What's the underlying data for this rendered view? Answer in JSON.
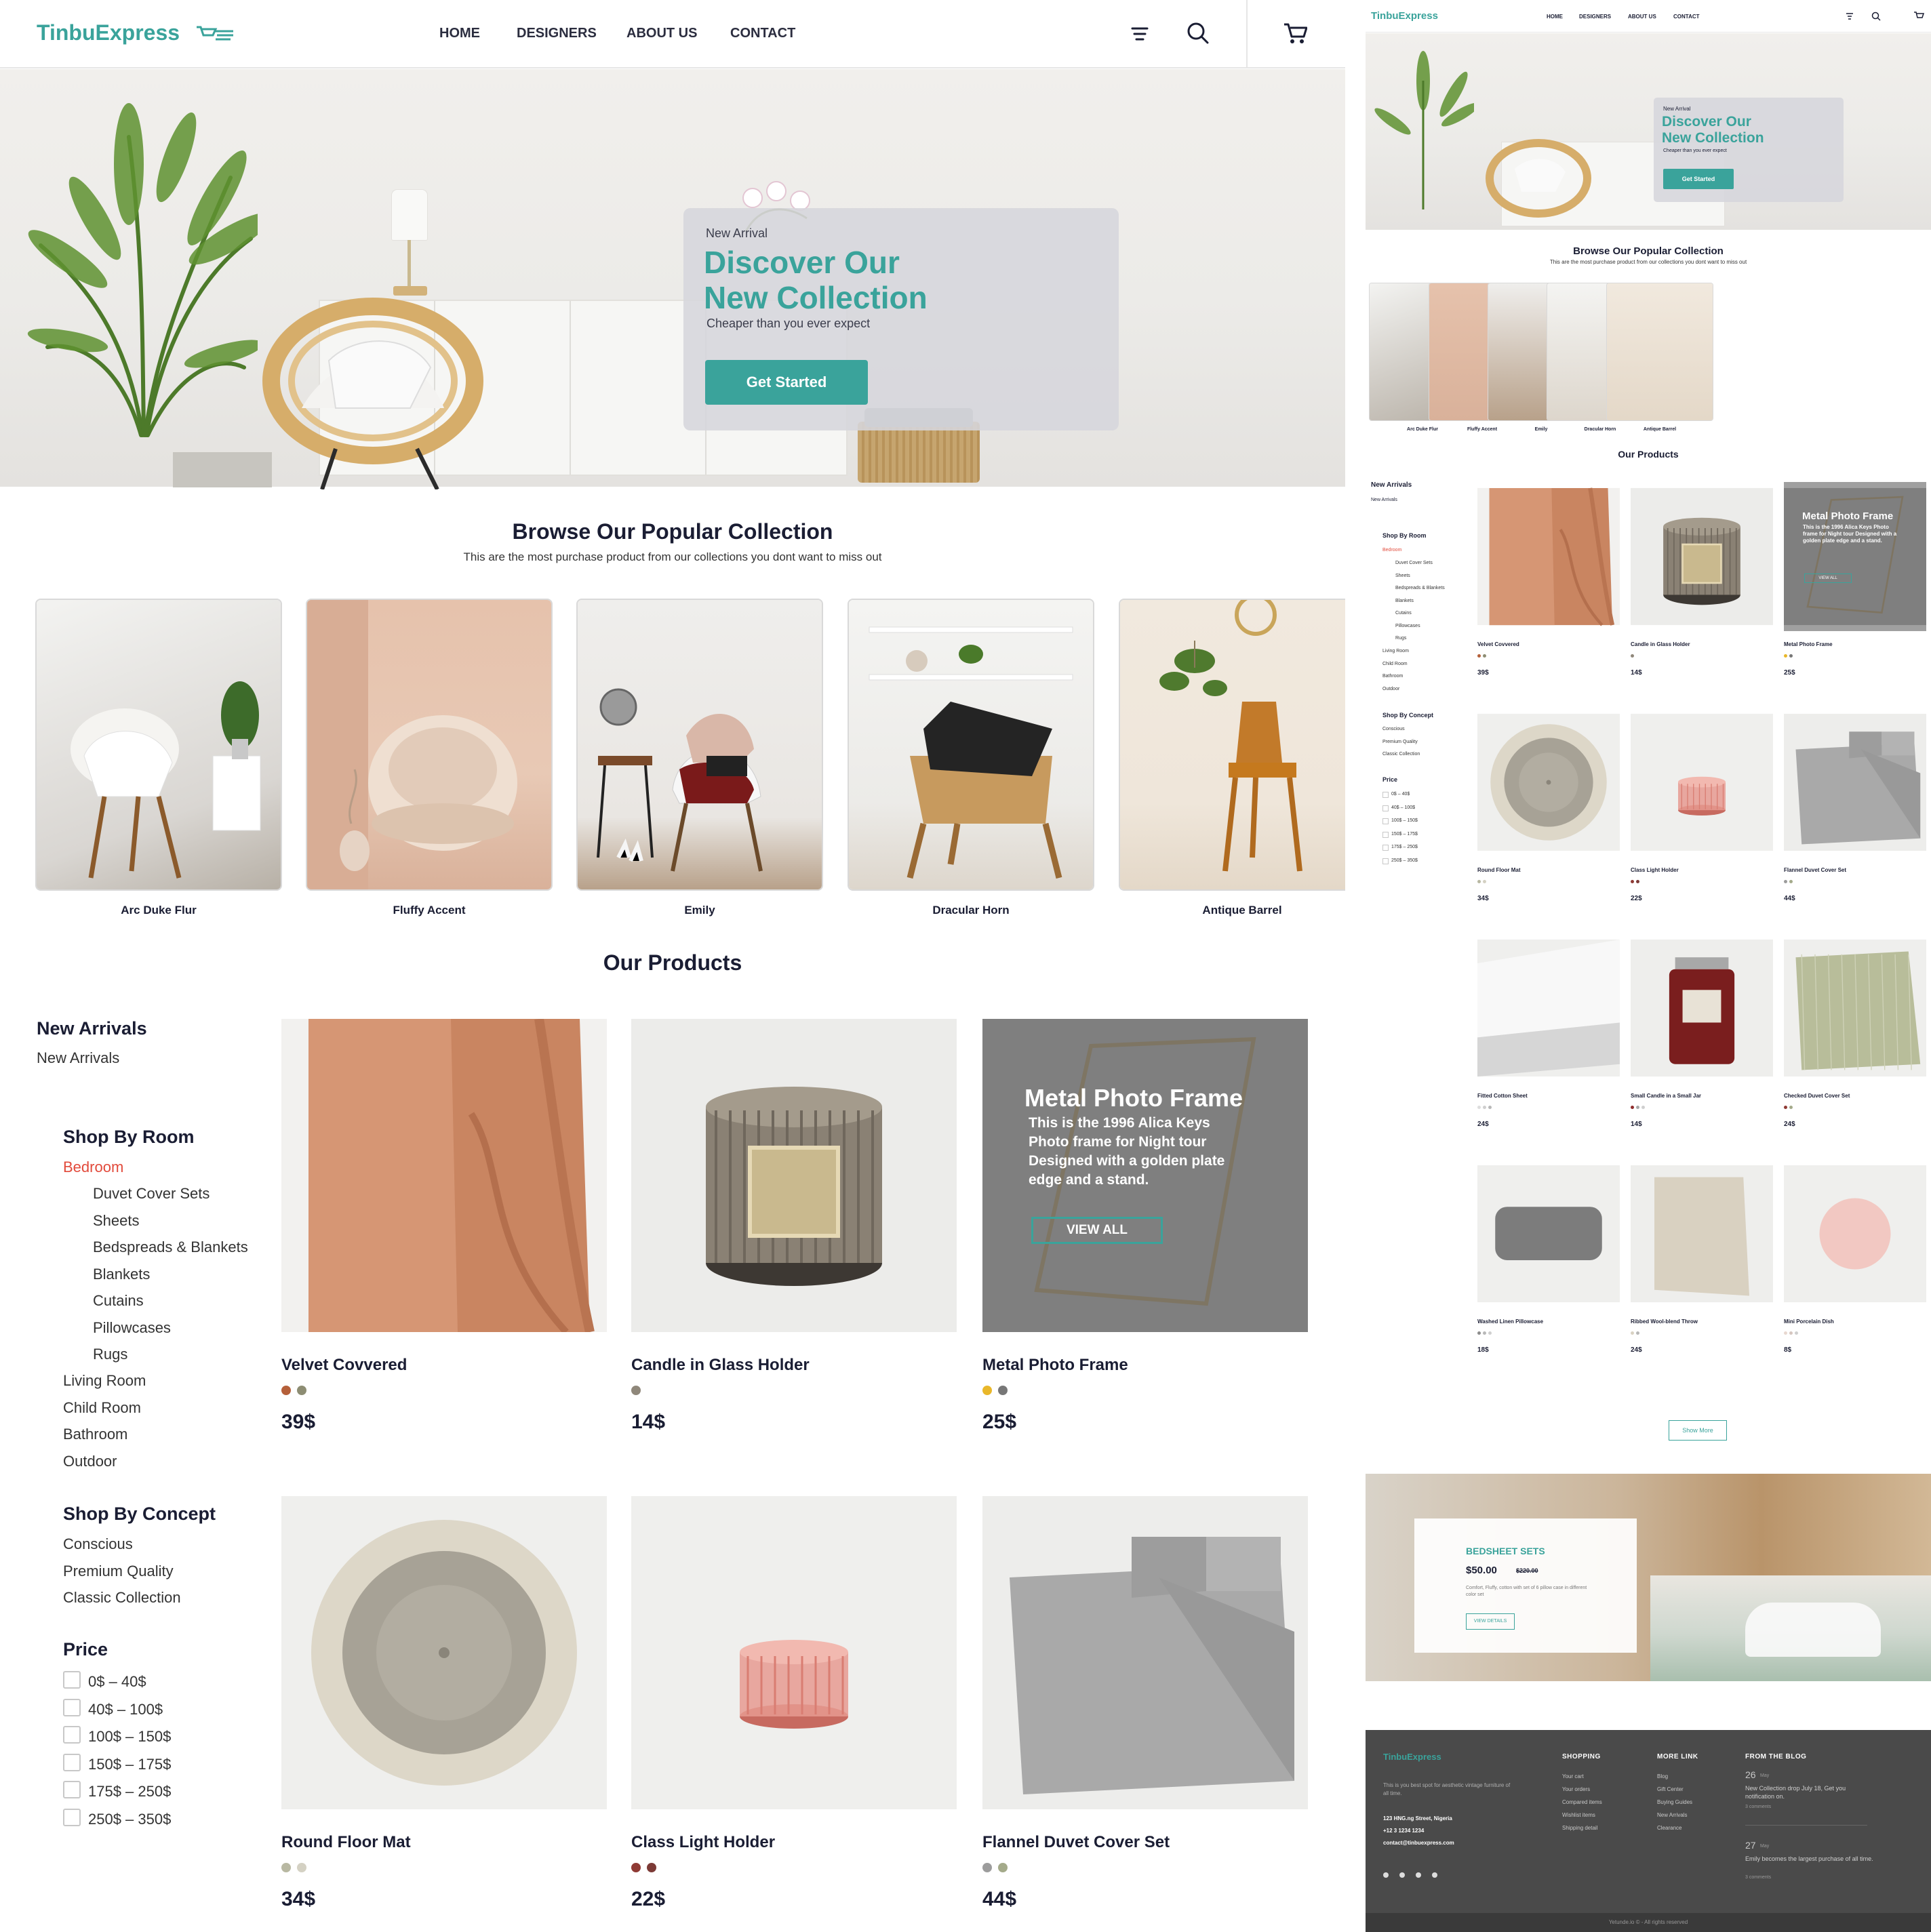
{
  "brand": {
    "name": "TinbuExpress",
    "accent": "#3aa39b",
    "dark": "#1a1d33",
    "sale": "#e24a3b"
  },
  "nav": {
    "items": [
      "HOME",
      "DESIGNERS",
      "ABOUT US",
      "CONTACT"
    ],
    "icons": [
      "menu-icon",
      "search-icon",
      "cart-icon"
    ]
  },
  "hero": {
    "eyebrow": "New Arrival",
    "title_line1": "Discover Our",
    "title_line2": "New Collection",
    "subtitle": "Cheaper than you ever expect",
    "cta": "Get Started"
  },
  "popular": {
    "title": "Browse Our Popular Collection",
    "subtitle": "This are the most purchase product from our collections you dont want to miss out",
    "items": [
      "Arc Duke Flur",
      "Fluffy Accent",
      "Emily",
      "Dracular Horn",
      "Antique Barrel"
    ]
  },
  "products_title": "Our Products",
  "sidebar": {
    "new_arrivals_heading": "New Arrivals",
    "new_arrivals_link": "New Arrivals",
    "room_heading": "Shop By Room",
    "room_active": "Bedroom",
    "room_sub": [
      "Duvet Cover Sets",
      "Sheets",
      "Bedspreads & Blankets",
      "Blankets",
      "Cutains",
      "Pillowcases",
      "Rugs"
    ],
    "rooms": [
      "Living Room",
      "Child Room",
      "Bathroom",
      "Outdoor"
    ],
    "concept_heading": "Shop By Concept",
    "concepts": [
      "Conscious",
      "Premium Quality",
      "Classic Collection"
    ],
    "price_heading": "Price",
    "prices": [
      "0$ – 40$",
      "40$ – 100$",
      "100$ – 150$",
      "150$ – 175$",
      "175$ – 250$",
      "250$ – 350$"
    ]
  },
  "products": [
    {
      "name": "Velvet Covvered",
      "price": "39$",
      "dots": [
        "#b5603a",
        "#8d8d73"
      ]
    },
    {
      "name": "Candle in Glass Holder",
      "price": "14$",
      "dots": [
        "#8f877a"
      ]
    },
    {
      "name": "Metal Photo Frame",
      "price": "25$",
      "dots": [
        "#e9b72a",
        "#777777"
      ]
    },
    {
      "name": "Round Floor Mat",
      "price": "34$",
      "dots": [
        "#b8b8a2",
        "#d4d1c3"
      ]
    },
    {
      "name": "Class Light Holder",
      "price": "22$",
      "dots": [
        "#8f3a34",
        "#7c3a36"
      ]
    },
    {
      "name": "Flannel Duvet Cover Set",
      "price": "44$",
      "dots": [
        "#9c9c9c",
        "#a4aa8a"
      ]
    },
    {
      "name": "Fitted Cotton Sheet",
      "price": "24$",
      "dots": [
        "#dddddd",
        "#cfcfcf",
        "#b8b8b8"
      ]
    },
    {
      "name": "Small Candle in a Small Jar",
      "price": "14$",
      "dots": [
        "#8f2c2c",
        "#a8a8a8",
        "#cfcfcf"
      ]
    },
    {
      "name": "Checked Duvet Cover Set",
      "price": "24$",
      "dots": [
        "#8f3a34",
        "#a4aa8a"
      ]
    },
    {
      "name": "Washed Linen Pillowcase",
      "price": "18$",
      "dots": [
        "#8d8d8d",
        "#b8b8b8",
        "#cfcfcf"
      ]
    },
    {
      "name": "Ribbed Wool-blend Throw",
      "price": "24$",
      "dots": [
        "#d9d2c2",
        "#b8b8b8"
      ]
    },
    {
      "name": "Mini Porcelain Dish",
      "price": "8$",
      "dots": [
        "#e8d8d0",
        "#d6c6c0",
        "#cfcfcf"
      ]
    }
  ],
  "hover": {
    "title": "Metal Photo Frame",
    "desc": "This is the 1996 Alica Keys Photo frame for Night tour Designed with a golden plate edge and a stand.",
    "cta": "VIEW ALL"
  },
  "show_more": "Show More",
  "promo": {
    "title": "BEDSHEET SETS",
    "price": "$50.00",
    "old_price": "$220.00",
    "desc": "Comfort, Fluffy, cotton with set of 6 pillow case in different color set",
    "cta": "VIEW DETAILS"
  },
  "footer": {
    "about": "This is you best spot for aesthetic vintage furniture of all time.",
    "address": "123 HNG.ng Street, Nigeria",
    "phone": "+12 3 1234 1234",
    "email": "contact@tinbuexpress.com",
    "shopping_heading": "SHOPPING",
    "shopping": [
      "Your cart",
      "Your orders",
      "Compared items",
      "Wishlist items",
      "Shipping detail"
    ],
    "more_heading": "MORE LINK",
    "more": [
      "Blog",
      "Gift Center",
      "Buying Guides",
      "New Arrivals",
      "Clearance"
    ],
    "blog_heading": "FROM THE BLOG",
    "posts": [
      {
        "day": "26",
        "month": "May",
        "text": "New Collection drop July 18, Get you notification on.",
        "comments": "3 comments"
      },
      {
        "day": "27",
        "month": "May",
        "text": "Emily becomes the largest purchase of all time.",
        "comments": "3 comments"
      }
    ],
    "copyright": "Yetunde.io © - All rights reserved"
  }
}
